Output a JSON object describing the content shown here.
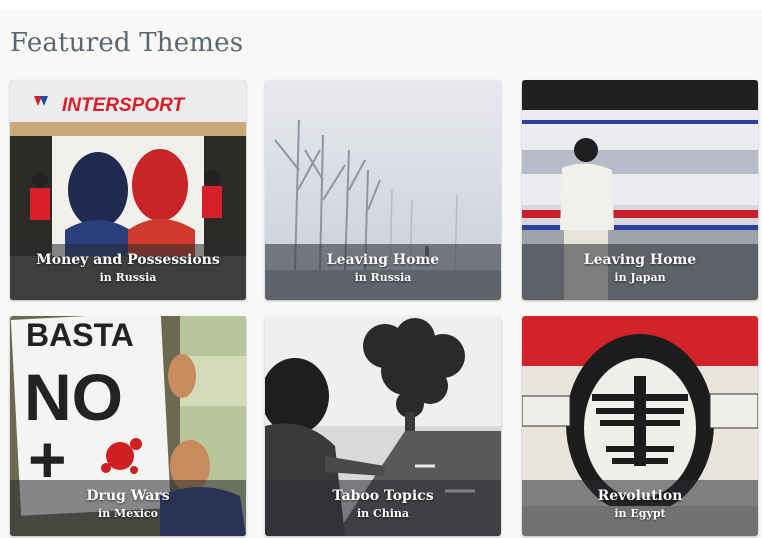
{
  "section": {
    "title": "Featured Themes"
  },
  "cards": [
    {
      "title": "Money and Possessions",
      "location": "in Russia",
      "image_text": "INTERSPORT"
    },
    {
      "title": "Leaving Home",
      "location": "in Russia"
    },
    {
      "title": "Leaving Home",
      "location": "in Japan"
    },
    {
      "title": "Drug Wars",
      "location": "in Mexico",
      "image_text": [
        "BASTA",
        "NO",
        "+"
      ]
    },
    {
      "title": "Taboo Topics",
      "location": "in China"
    },
    {
      "title": "Revolution",
      "location": "in Egypt"
    }
  ],
  "colors": {
    "title": "#5b6770",
    "caption_overlay": "rgba(40,44,50,0.55)",
    "caption_text": "#ffffff",
    "intersport_blue": "#1d4aa6",
    "intersport_red": "#d8202a"
  }
}
